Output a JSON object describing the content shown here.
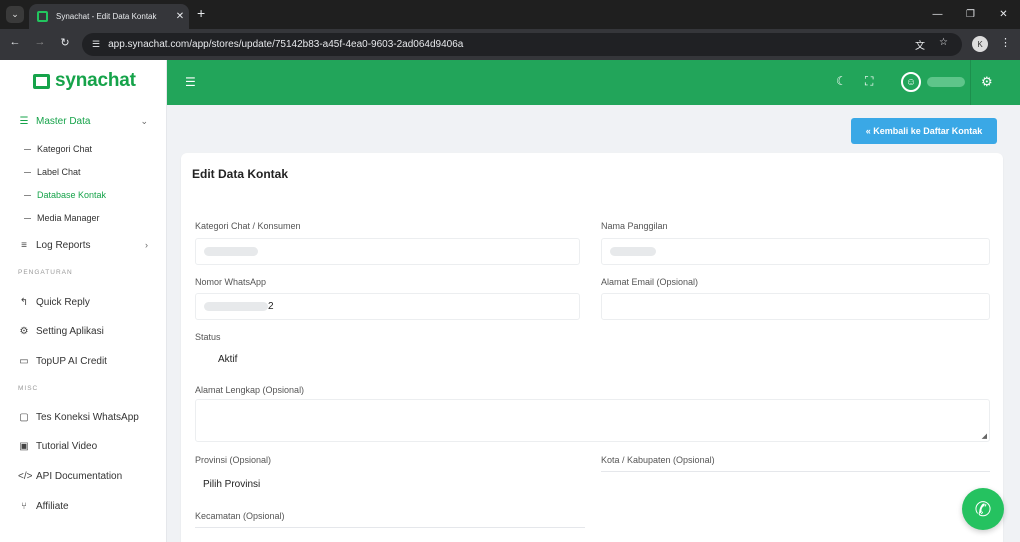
{
  "browser": {
    "tab_title": "Synachat - Edit Data Kontak",
    "url": "app.synachat.com/app/stores/update/75142b83-a45f-4ea0-9603-2ad064d9406a",
    "profile_initial": "K"
  },
  "sidebar": {
    "logo": "synachat",
    "master_data": "Master Data",
    "sub_items": [
      "Kategori Chat",
      "Label Chat",
      "Database Kontak",
      "Media Manager"
    ],
    "log_reports": "Log Reports",
    "section_pengaturan": "PENGATURAN",
    "quick_reply": "Quick Reply",
    "setting_aplikasi": "Setting Aplikasi",
    "topup": "TopUP AI Credit",
    "section_misc": "MISC",
    "tes_koneksi": "Tes Koneksi WhatsApp",
    "tutorial": "Tutorial Video",
    "api_docs": "API Documentation",
    "affiliate": "Affiliate"
  },
  "header": {
    "user_name": "username"
  },
  "content": {
    "back_button": "« Kembali ke Daftar Kontak",
    "card_title": "Edit Data Kontak",
    "labels": {
      "kategori": "Kategori Chat / Konsumen",
      "nama": "Nama Panggilan",
      "nomor": "Nomor WhatsApp",
      "email": "Alamat Email (Opsional)",
      "status": "Status",
      "alamat": "Alamat Lengkap (Opsional)",
      "provinsi": "Provinsi (Opsional)",
      "kota": "Kota / Kabupaten (Opsional)",
      "kecamatan": "Kecamatan (Opsional)"
    },
    "values": {
      "nomor_suffix": "2",
      "status": "Aktif",
      "provinsi": "Pilih Provinsi"
    }
  },
  "colors": {
    "brand_green": "#22a55a",
    "accent_blue": "#3aa8e6"
  }
}
